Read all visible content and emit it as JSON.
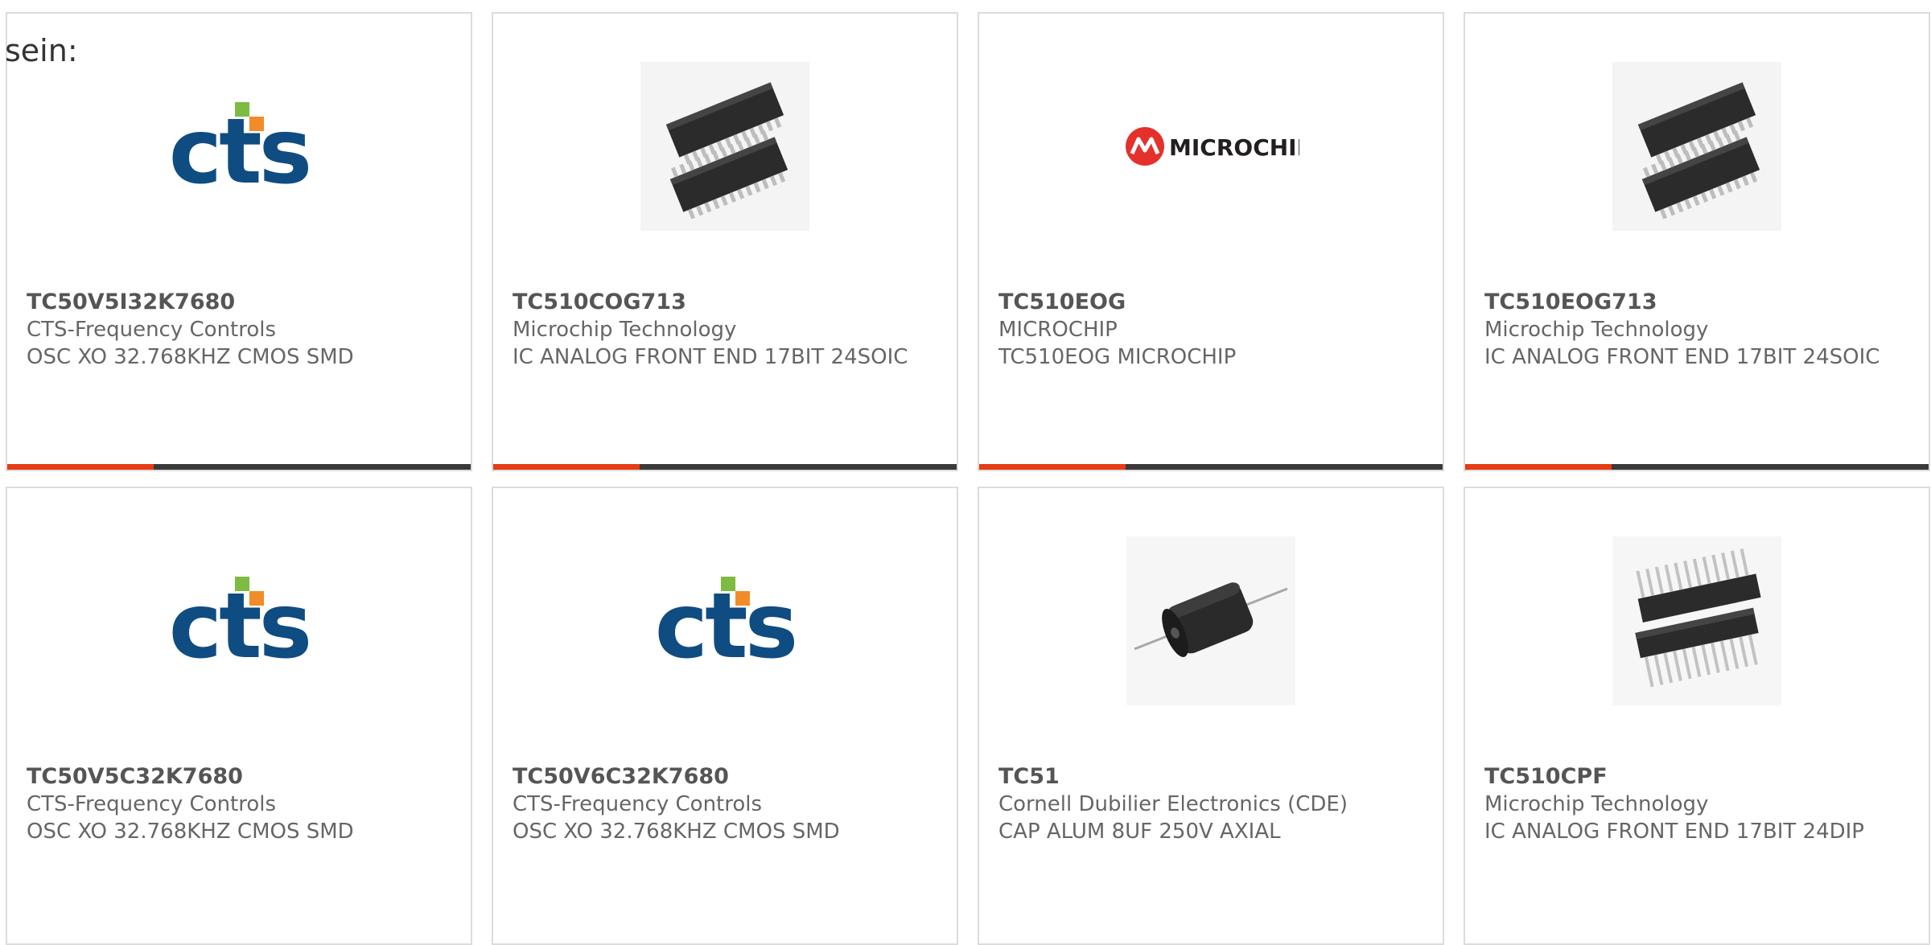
{
  "intro_text": "sein:",
  "colors": {
    "accent": "#e63c14",
    "bar_dark": "#3a3a3a",
    "card_border": "#dcdcdc",
    "text": "#666666",
    "cts_blue": "#0f4c81",
    "cts_green": "#7dbb42",
    "cts_orange": "#f28c28",
    "microchip_red": "#e4312b"
  },
  "products": [
    {
      "part_number": "TC50V5I32K7680",
      "manufacturer": "CTS-Frequency Controls",
      "description": "OSC XO 32.768KHZ CMOS SMD",
      "image": "cts-logo"
    },
    {
      "part_number": "TC510COG713",
      "manufacturer": "Microchip Technology",
      "description": "IC ANALOG FRONT END 17BIT 24SOIC",
      "image": "soic-chip"
    },
    {
      "part_number": "TC510EOG",
      "manufacturer": "MICROCHIP",
      "description": "TC510EOG MICROCHIP",
      "image": "microchip-logo"
    },
    {
      "part_number": "TC510EOG713",
      "manufacturer": "Microchip Technology",
      "description": "IC ANALOG FRONT END 17BIT 24SOIC",
      "image": "soic-chip"
    },
    {
      "part_number": "TC50V5C32K7680",
      "manufacturer": "CTS-Frequency Controls",
      "description": "OSC XO 32.768KHZ CMOS SMD",
      "image": "cts-logo"
    },
    {
      "part_number": "TC50V6C32K7680",
      "manufacturer": "CTS-Frequency Controls",
      "description": "OSC XO 32.768KHZ CMOS SMD",
      "image": "cts-logo"
    },
    {
      "part_number": "TC51",
      "manufacturer": "Cornell Dubilier Electronics (CDE)",
      "description": "CAP ALUM 8UF 250V AXIAL",
      "image": "axial-capacitor"
    },
    {
      "part_number": "TC510CPF",
      "manufacturer": "Microchip Technology",
      "description": "IC ANALOG FRONT END 17BIT 24DIP",
      "image": "dip-chip"
    }
  ],
  "logo_text": {
    "cts": "CTS",
    "microchip": "MICROCHIP"
  }
}
